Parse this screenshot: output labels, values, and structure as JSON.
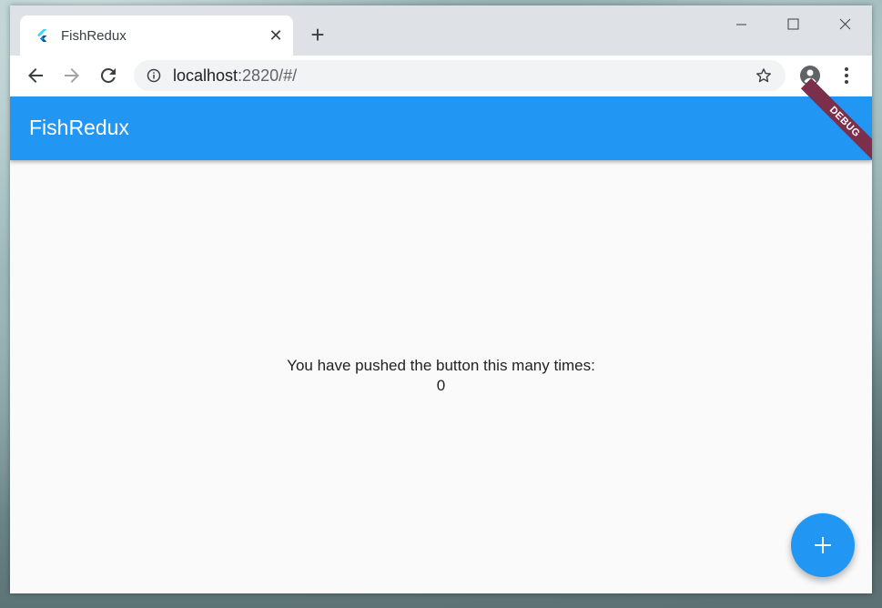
{
  "browser": {
    "tab": {
      "title": "FishRedux",
      "close_symbol": "✕"
    },
    "new_tab_symbol": "+",
    "address": {
      "host": "localhost",
      "rest": ":2820/#/"
    }
  },
  "app": {
    "title": "FishRedux",
    "debug_banner": "DEBUG",
    "message": "You have pushed the button this many times:",
    "counter": "0"
  },
  "colors": {
    "primary": "#2196f3",
    "debug_banner": "#7b2f4a",
    "background": "#fafafa"
  },
  "icons": {
    "favicon": "flutter-icon",
    "back": "arrow-back-icon",
    "forward": "arrow-forward-icon",
    "reload": "reload-icon",
    "site_info": "info-icon",
    "bookmark": "star-icon",
    "profile": "account-icon",
    "menu": "more-vert-icon",
    "fab": "add-icon"
  }
}
